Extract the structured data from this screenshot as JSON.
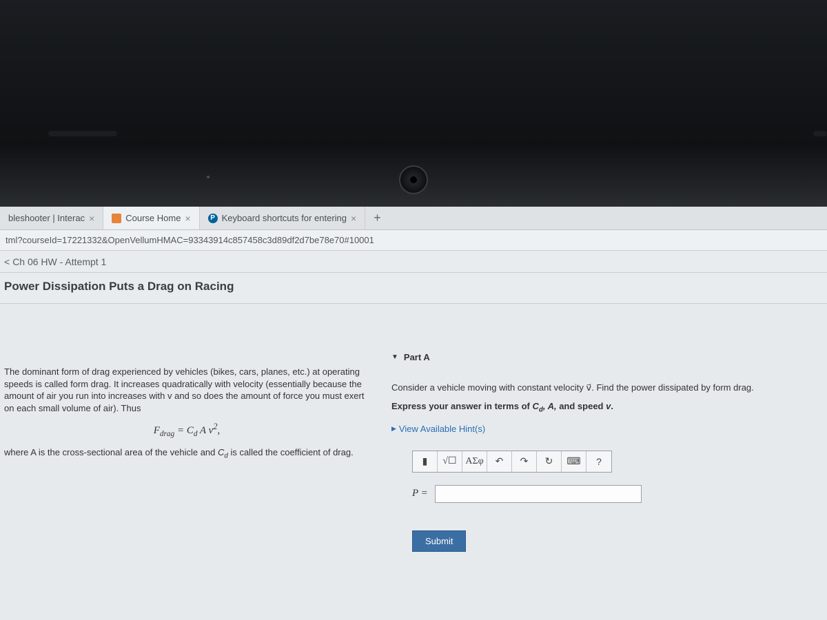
{
  "tabs": [
    {
      "label": "bleshooter | Interac",
      "favicon": ""
    },
    {
      "label": "Course Home",
      "favicon": "orange"
    },
    {
      "label": "Keyboard shortcuts for entering",
      "favicon": "pearson"
    }
  ],
  "tab_close_glyph": "×",
  "newtab_glyph": "+",
  "url": "tml?courseId=17221332&OpenVellumHMAC=93343914c857458c3d89df2d7be78e70#10001",
  "breadcrumb": {
    "caret": "<",
    "label": "Ch 06 HW - Attempt 1"
  },
  "page_title": "Power Dissipation Puts a Drag on Racing",
  "left": {
    "para1": "The dominant form of drag experienced by vehicles (bikes, cars, planes, etc.) at operating speeds is called form drag. It increases quadratically with velocity (essentially because the amount of air you run into increases with v and so does the amount of force you must exert on each small volume of air). Thus",
    "formula": "Fdrag = Cd A v²,",
    "para2_a": "where A is the cross-sectional area of the vehicle and ",
    "para2_b": " is called the coefficient of drag.",
    "cd_sym": "Cd"
  },
  "right": {
    "part_label": "Part A",
    "prompt": "Consider a vehicle moving with constant velocity v⃗. Find the power dissipated by form drag.",
    "express_a": "Express your answer in terms of ",
    "express_vars": "Cd, A,",
    "express_b": " and speed ",
    "express_v": "v",
    "express_c": ".",
    "hints_label": "View Available Hint(s)",
    "toolbar": {
      "templates": "▮",
      "sqrt": "√☐",
      "greek": "ΑΣφ",
      "undo": "↶",
      "redo": "↷",
      "reset": "↻",
      "keyboard": "⌨",
      "help": "?"
    },
    "lhs": "P =",
    "input_value": "",
    "submit": "Submit"
  }
}
